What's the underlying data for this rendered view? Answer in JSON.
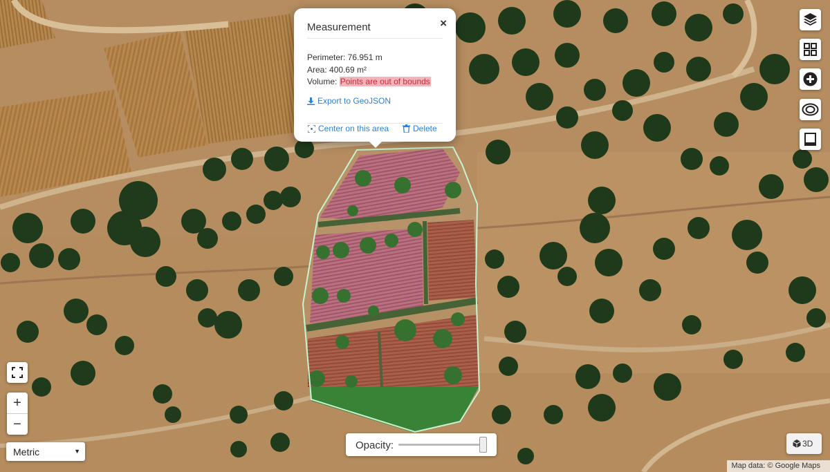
{
  "popup": {
    "title": "Measurement",
    "close_glyph": "×",
    "perimeter": "Perimeter: 76.951 m",
    "area": "Area: 400.69 m²",
    "volume_label": "Volume:",
    "volume_value": "Points are out of bounds",
    "export_label": "Export to GeoJSON",
    "center_label": "Center on this area",
    "delete_label": "Delete"
  },
  "toolbar": {
    "icons": [
      "layers-icon",
      "grid-icon",
      "plus-circle-icon",
      "eye-icon",
      "book-icon"
    ]
  },
  "zoom": {
    "in_label": "+",
    "out_label": "−"
  },
  "units": {
    "selected": "Metric"
  },
  "opacity": {
    "label": "Opacity:",
    "value": 1.0
  },
  "view3d": {
    "label": "3D"
  },
  "attribution": "Map data: © Google Maps",
  "colors": {
    "accent": "#2b83d6",
    "error_bg": "#f4b3b8",
    "error_text": "#c0303c",
    "polygon_outline": "#c6f3d1"
  }
}
